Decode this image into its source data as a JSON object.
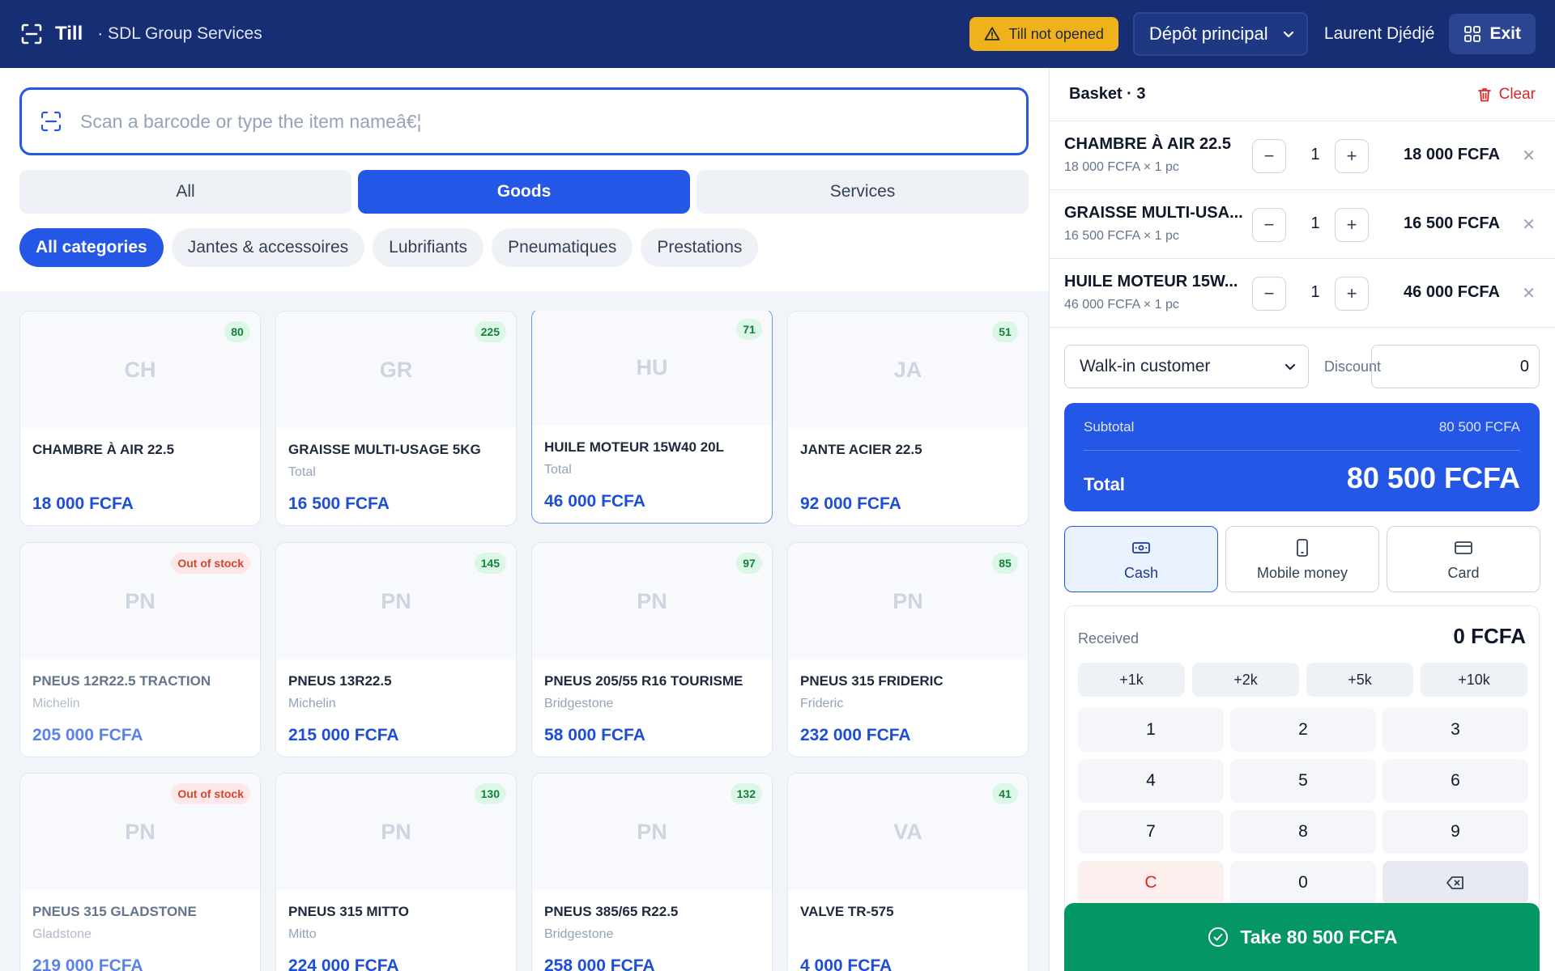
{
  "header": {
    "app_title": "Till",
    "org": "· SDL Group Services",
    "status_badge": "Till not opened",
    "location": "Dépôt principal",
    "user": "Laurent Djédjé",
    "exit_label": "Exit",
    "colors": {
      "bar": "#172d74",
      "warning": "#f0b21a"
    }
  },
  "search": {
    "placeholder": "Scan a barcode or type the item nameâ€¦",
    "icon": "barcode-scan-icon"
  },
  "tabs": [
    {
      "label": "All",
      "active": false
    },
    {
      "label": "Goods",
      "active": true
    },
    {
      "label": "Services",
      "active": false
    }
  ],
  "categories": [
    {
      "label": "All categories",
      "active": true
    },
    {
      "label": "Jantes & accessoires",
      "active": false
    },
    {
      "label": "Lubrifiants",
      "active": false
    },
    {
      "label": "Pneumatiques",
      "active": false
    },
    {
      "label": "Prestations",
      "active": false
    }
  ],
  "products": [
    {
      "initials": "CH",
      "stock": "80",
      "out": false,
      "name": "CHAMBRE À AIR 22.5",
      "brand": "",
      "price": "18 000 FCFA",
      "selected": false
    },
    {
      "initials": "GR",
      "stock": "225",
      "out": false,
      "name": "GRAISSE MULTI-USAGE 5KG",
      "brand": "Total",
      "price": "16 500 FCFA",
      "selected": false
    },
    {
      "initials": "HU",
      "stock": "71",
      "out": false,
      "name": "HUILE MOTEUR 15W40 20L",
      "brand": "Total",
      "price": "46 000 FCFA",
      "selected": true
    },
    {
      "initials": "JA",
      "stock": "51",
      "out": false,
      "name": "JANTE ACIER 22.5",
      "brand": "",
      "price": "92 000 FCFA",
      "selected": false
    },
    {
      "initials": "PN",
      "stock": "Out of stock",
      "out": true,
      "name": "PNEUS 12R22.5 TRACTION",
      "brand": "Michelin",
      "price": "205 000 FCFA",
      "selected": false
    },
    {
      "initials": "PN",
      "stock": "145",
      "out": false,
      "name": "PNEUS 13R22.5",
      "brand": "Michelin",
      "price": "215 000 FCFA",
      "selected": false
    },
    {
      "initials": "PN",
      "stock": "97",
      "out": false,
      "name": "PNEUS 205/55 R16 TOURISME",
      "brand": "Bridgestone",
      "price": "58 000 FCFA",
      "selected": false
    },
    {
      "initials": "PN",
      "stock": "85",
      "out": false,
      "name": "PNEUS 315 FRIDERIC",
      "brand": "Frideric",
      "price": "232 000 FCFA",
      "selected": false
    },
    {
      "initials": "PN",
      "stock": "Out of stock",
      "out": true,
      "name": "PNEUS 315 GLADSTONE",
      "brand": "Gladstone",
      "price": "219 000 FCFA",
      "selected": false
    },
    {
      "initials": "PN",
      "stock": "130",
      "out": false,
      "name": "PNEUS 315 MITTO",
      "brand": "Mitto",
      "price": "224 000 FCFA",
      "selected": false
    },
    {
      "initials": "PN",
      "stock": "132",
      "out": false,
      "name": "PNEUS 385/65 R22.5",
      "brand": "Bridgestone",
      "price": "258 000 FCFA",
      "selected": false
    },
    {
      "initials": "VA",
      "stock": "41",
      "out": false,
      "name": "VALVE TR-575",
      "brand": "",
      "price": "4 000 FCFA",
      "selected": false
    }
  ],
  "basket": {
    "title": "Basket · 3",
    "clear_label": "Clear",
    "lines": [
      {
        "name": "CHAMBRE À AIR 22.5",
        "sub": "18 000 FCFA × 1 pc",
        "qty": "1",
        "total": "18 000 FCFA"
      },
      {
        "name": "GRAISSE MULTI-USA...",
        "sub": "16 500 FCFA × 1 pc",
        "qty": "1",
        "total": "16 500 FCFA"
      },
      {
        "name": "HUILE MOTEUR 15W...",
        "sub": "46 000 FCFA × 1 pc",
        "qty": "1",
        "total": "46 000 FCFA"
      }
    ]
  },
  "customer": {
    "selected": "Walk-in customer",
    "discount_label": "Discount",
    "discount_value": "0"
  },
  "totals": {
    "subtotal_label": "Subtotal",
    "subtotal": "80 500 FCFA",
    "total_label": "Total",
    "total": "80 500 FCFA"
  },
  "payment_methods": [
    {
      "label": "Cash",
      "icon": "cash-icon",
      "active": true
    },
    {
      "label": "Mobile money",
      "icon": "mobile-icon",
      "active": false
    },
    {
      "label": "Card",
      "icon": "card-icon",
      "active": false
    }
  ],
  "keypad": {
    "received_label": "Received",
    "received_value": "0 FCFA",
    "quick": [
      "+1k",
      "+2k",
      "+5k",
      "+10k"
    ],
    "keys": [
      "1",
      "2",
      "3",
      "4",
      "5",
      "6",
      "7",
      "8",
      "9",
      "C",
      "0"
    ]
  },
  "take_button": "Take 80 500 FCFA"
}
